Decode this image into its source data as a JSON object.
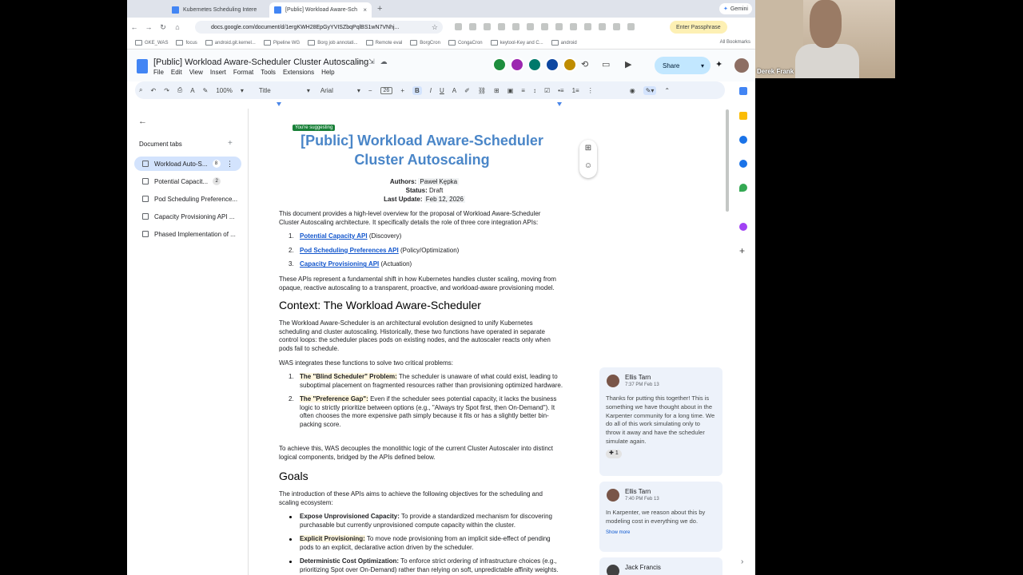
{
  "browser": {
    "tabs": [
      {
        "title": "Kubernetes Scheduling Intere"
      },
      {
        "title": "[Public] Workload Aware-Sch"
      }
    ],
    "gemini_label": "Gemini",
    "url": "docs.google.com/document/d/1ergKWH28EpGyYVISZbqPqlBS1wN7VNhj...",
    "passphrase_label": "Enter Passphrase",
    "bookmarks": [
      "GKE_WAS",
      "focus",
      "android.git.kernel...",
      "Pipeline WG",
      "Borg job annotati...",
      "Remote eval",
      "BorgCron",
      "CongaCron",
      "keytool-Key and C...",
      "android"
    ],
    "all_bookmarks": "All Bookmarks"
  },
  "doc": {
    "title": "[Public] Workload Aware-Scheduler Cluster Autoscaling",
    "menus": [
      "File",
      "Edit",
      "View",
      "Insert",
      "Format",
      "Tools",
      "Extensions",
      "Help"
    ],
    "share_label": "Share",
    "collaborator_colors": [
      "#1e8e3e",
      "#9c27b0",
      "#00796b",
      "#0d47a1",
      "#bf8c00"
    ]
  },
  "toolbar": {
    "zoom": "100%",
    "style": "Title",
    "font": "Arial",
    "size": "26"
  },
  "side_panel": {
    "title": "Document tabs",
    "tabs": [
      {
        "label": "Workload Auto-S...",
        "count": "8"
      },
      {
        "label": "Potential Capacit...",
        "count": "2"
      },
      {
        "label": "Pod Scheduling Preference..."
      },
      {
        "label": "Capacity Provisioning API ..."
      },
      {
        "label": "Phased Implementation of ..."
      }
    ]
  },
  "page": {
    "suggesting_badge": "You're suggesting",
    "title_line1": "[Public] Workload Aware-Scheduler",
    "title_line2": "Cluster Autoscaling",
    "authors_label": "Authors:",
    "authors_value": "Paweł Kępka",
    "status_label": "Status:",
    "status_value": "Draft",
    "update_label": "Last Update:",
    "update_value": "Feb 12, 2026",
    "intro": "This document provides a high-level overview for the proposal of Workload Aware-Scheduler Cluster Autoscaling architecture. It specifically details the role of three core integration APIs:",
    "apis": [
      {
        "num": "1.",
        "link": "Potential Capacity API",
        "rest": " (Discovery)"
      },
      {
        "num": "2.",
        "link": "Pod Scheduling Preferences API",
        "rest": " (Policy/Optimization)"
      },
      {
        "num": "3.",
        "link": "Capacity Provisioning API",
        "rest": " (Actuation)"
      }
    ],
    "shift_para": "These APIs represent a fundamental shift in how Kubernetes handles cluster scaling, moving from opaque, reactive autoscaling to a transparent, proactive, and workload-aware provisioning model.",
    "context_heading": "Context: The Workload Aware-Scheduler",
    "context_para": "The Workload Aware-Scheduler is an architectural evolution designed to unify Kubernetes scheduling and cluster autoscaling. Historically, these two functions have operated in separate control loops: the scheduler places pods on existing nodes, and the autoscaler reacts only when pods fail to schedule.",
    "was_para": "WAS integrates these functions to solve two critical problems:",
    "problems": [
      {
        "num": "1.",
        "bold": "The \"Blind Scheduler\" Problem:",
        "rest": " The scheduler is unaware of what could exist, leading to suboptimal placement on fragmented resources rather than provisioning optimized hardware."
      },
      {
        "num": "2.",
        "bold": "The \"Preference Gap\":",
        "rest": " Even if the scheduler sees potential capacity, it lacks the business logic to strictly prioritize between options (e.g., \"Always try Spot first, then On-Demand\"). It often chooses the more expensive path simply because it fits or has a slightly better bin-packing score."
      }
    ],
    "achieve_para": "To achieve this, WAS decouples the monolithic logic of the current Cluster Autoscaler into distinct logical components, bridged by the APIs defined below.",
    "goals_heading": "Goals",
    "goals_para": "The introduction of these APIs aims to achieve the following objectives for the scheduling and scaling ecosystem:",
    "goals": [
      {
        "bold": "Expose Unprovisioned Capacity:",
        "rest": " To provide a standardized mechanism for discovering purchasable but currently unprovisioned compute capacity within the cluster."
      },
      {
        "bold": "Explicit Provisioning:",
        "rest": " To move node provisioning from an implicit side-effect of pending pods to an explicit, declarative action driven by the scheduler."
      },
      {
        "bold": "Deterministic Cost Optimization:",
        "rest": " To enforce strict ordering of infrastructure choices (e.g., prioritizing Spot over On-Demand) rather than relying on soft, unpredictable affinity weights."
      }
    ]
  },
  "comments": [
    {
      "author": "Ellis Tarn",
      "time": "7:37 PM Feb 13",
      "body": "Thanks for putting this together! This is something we have thought about in the Karpenter community for a long time. We do all of this work simulating only to throw it away and have the scheduler simulate again.",
      "reaction": "1"
    },
    {
      "author": "Ellis Tarn",
      "time": "7:40 PM Feb 13",
      "body": "In Karpenter, we reason about this by modeling cost in everything we do.",
      "show_more": "Show more"
    },
    {
      "author": "Jack Francis"
    }
  ],
  "video": {
    "participant": "Derek Frank"
  }
}
